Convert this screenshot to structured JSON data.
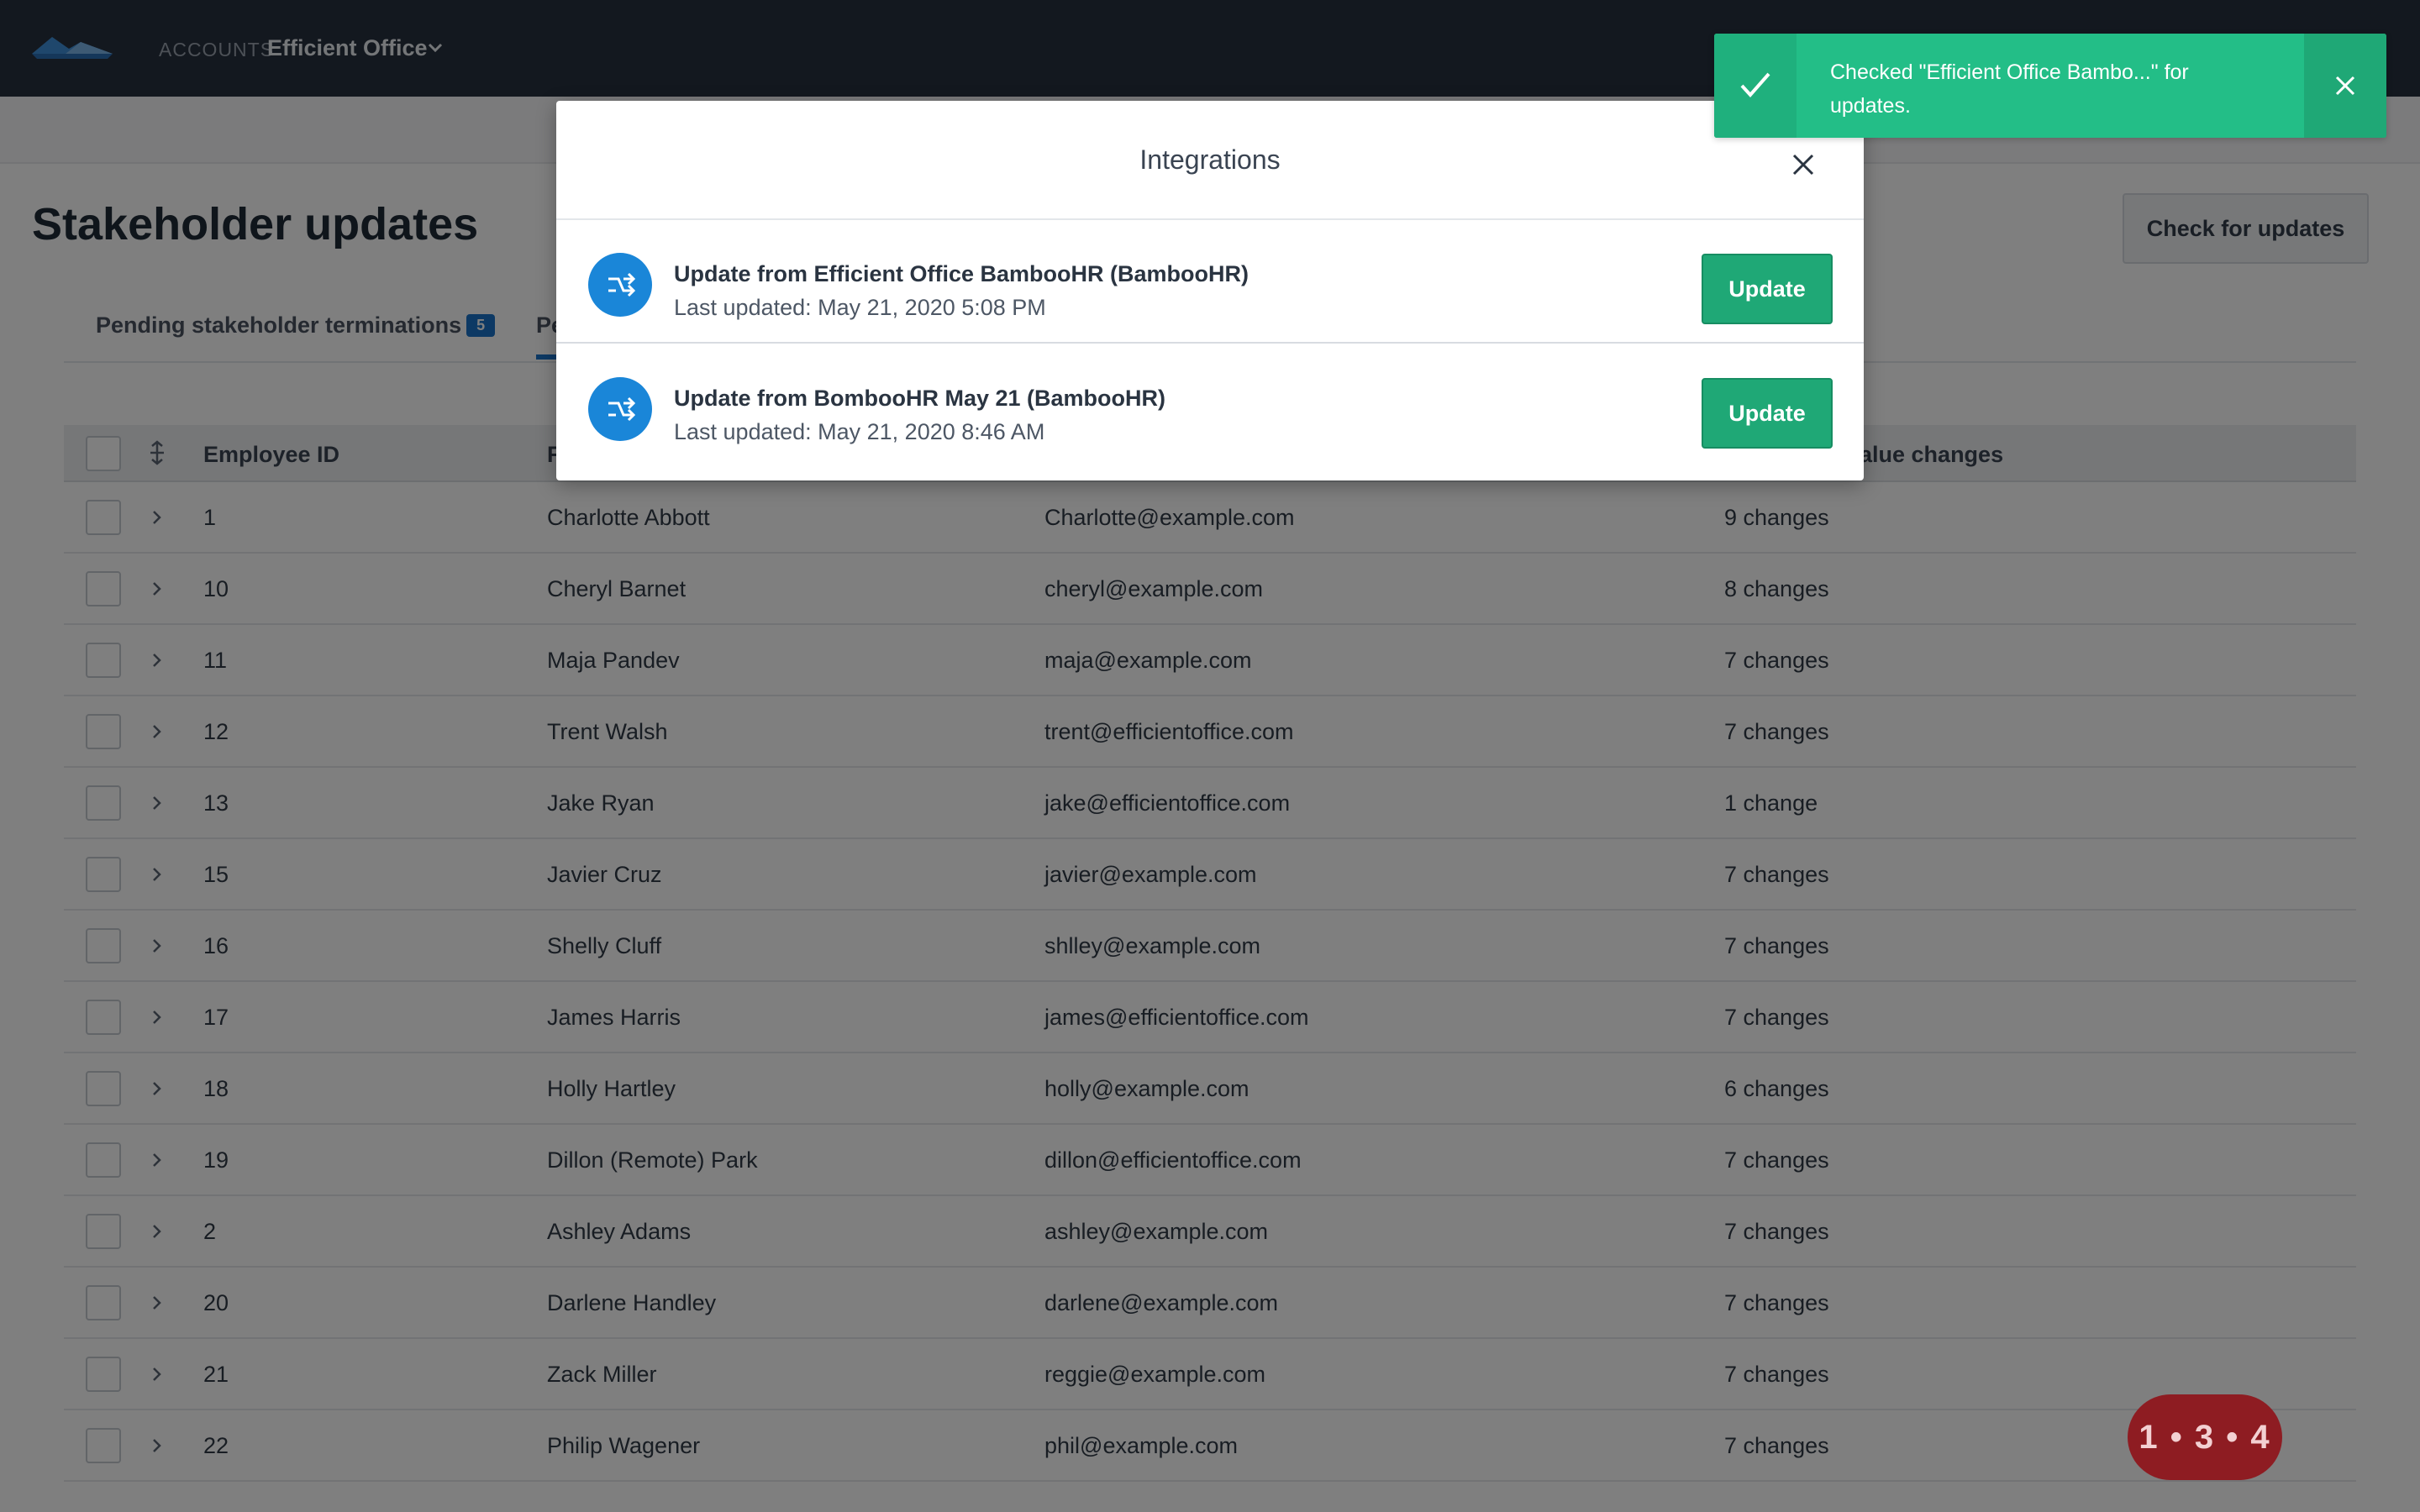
{
  "nav": {
    "accounts_label": "ACCOUNTS",
    "account_name": "Efficient Office"
  },
  "page": {
    "title": "Stakeholder updates",
    "check_button": "Check for updates",
    "tabs": [
      {
        "label": "Pending stakeholder terminations",
        "badge": "5"
      },
      {
        "label": "Pe"
      }
    ]
  },
  "table": {
    "headers": {
      "employee_id": "Employee ID",
      "name": "F",
      "value_changes": "value changes"
    },
    "rows": [
      {
        "id": "1",
        "name": "Charlotte Abbott",
        "email": "Charlotte@example.com",
        "changes": "9 changes"
      },
      {
        "id": "10",
        "name": "Cheryl Barnet",
        "email": "cheryl@example.com",
        "changes": "8 changes"
      },
      {
        "id": "11",
        "name": "Maja Pandev",
        "email": "maja@example.com",
        "changes": "7 changes"
      },
      {
        "id": "12",
        "name": "Trent Walsh",
        "email": "trent@efficientoffice.com",
        "changes": "7 changes"
      },
      {
        "id": "13",
        "name": "Jake Ryan",
        "email": "jake@efficientoffice.com",
        "changes": "1 change"
      },
      {
        "id": "15",
        "name": "Javier Cruz",
        "email": "javier@example.com",
        "changes": "7 changes"
      },
      {
        "id": "16",
        "name": "Shelly Cluff",
        "email": "shlley@example.com",
        "changes": "7 changes"
      },
      {
        "id": "17",
        "name": "James Harris",
        "email": "james@efficientoffice.com",
        "changes": "7 changes"
      },
      {
        "id": "18",
        "name": "Holly Hartley",
        "email": "holly@example.com",
        "changes": "6 changes"
      },
      {
        "id": "19",
        "name": "Dillon (Remote) Park",
        "email": "dillon@efficientoffice.com",
        "changes": "7 changes"
      },
      {
        "id": "2",
        "name": "Ashley Adams",
        "email": "ashley@example.com",
        "changes": "7 changes"
      },
      {
        "id": "20",
        "name": "Darlene Handley",
        "email": "darlene@example.com",
        "changes": "7 changes"
      },
      {
        "id": "21",
        "name": "Zack Miller",
        "email": "reggie@example.com",
        "changes": "7 changes"
      },
      {
        "id": "22",
        "name": "Philip Wagener",
        "email": "phil@example.com",
        "changes": "7 changes"
      }
    ]
  },
  "modal": {
    "title": "Integrations",
    "items": [
      {
        "title": "Update from Efficient Office BambooHR (BambooHR)",
        "subtitle": "Last updated: May 21, 2020 5:08 PM",
        "button": "Update"
      },
      {
        "title": "Update from BombooHR May 21 (BambooHR)",
        "subtitle": "Last updated: May 21, 2020 8:46 AM",
        "button": "Update"
      }
    ]
  },
  "toast": {
    "message": "Checked \"Efficient Office Bambo...\" for updates."
  },
  "floating_badge": "1 • 3 • 4"
}
